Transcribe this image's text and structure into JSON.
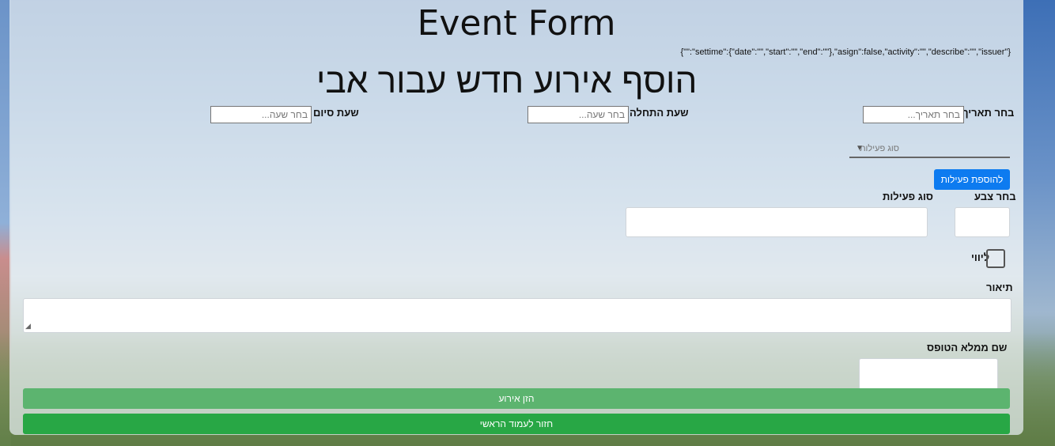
{
  "page": {
    "title": "Event Form",
    "json_debug": "{\"\":\"settime\":{\"date\":\"\",\"start\":\"\",\"end\":\"\"},\"asign\":false,\"activity\":\"\",\"describe\":\"\",\"issuer\"}",
    "subtitle": "הוסף אירוע חדש עבור אבי"
  },
  "form": {
    "date_label": "בחר תאריך",
    "date_placeholder": "בחר תאריך...",
    "start_label": "שעת התחלה",
    "start_placeholder": "בחר שעה...",
    "end_label": "שעת סיום",
    "end_placeholder": "בחר שעה...",
    "activity_select_placeholder": "סוג פעילות",
    "add_activities_button": "להוספת פעילות",
    "color_label": "בחר צבע",
    "activity_type_label": "סוג פעילות",
    "escort_label": "ליווי",
    "description_label": "תיאור",
    "issuer_label": "שם ממלא הטופס",
    "submit_button": "הזן אירוע",
    "back_button": "חזור לעמוד הראשי"
  }
}
